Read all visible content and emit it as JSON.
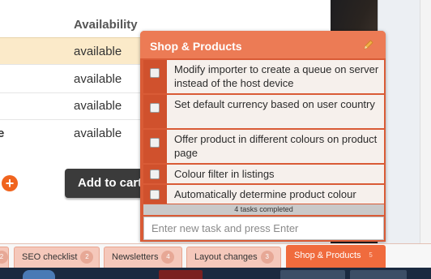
{
  "shop": {
    "availability_header": "Availability",
    "rows": [
      {
        "cut_label": "",
        "value": "available"
      },
      {
        "cut_label": "",
        "value": "available"
      },
      {
        "cut_label": "",
        "value": "available"
      },
      {
        "cut_label": "e",
        "value": "available"
      }
    ],
    "add_to_cart_label": "Add to cart",
    "plus_icon": "+"
  },
  "widget": {
    "title": "Shop & Products",
    "edit_icon": "pencil-icon",
    "tasks": [
      {
        "text": "Modify importer to create a queue on server instead of the host device",
        "checked": false
      },
      {
        "text": "Set default currency based on user country",
        "checked": false
      },
      {
        "text": "Offer product in different colours on product page",
        "checked": false
      },
      {
        "text": "Colour filter in listings",
        "checked": false
      },
      {
        "text": "Automatically determine product colour",
        "checked": false
      }
    ],
    "progress_text": "4 tasks completed",
    "new_task_placeholder": "Enter new task and press Enter"
  },
  "tabs": [
    {
      "label": "",
      "count": "2",
      "active": false
    },
    {
      "label": "SEO checklist",
      "count": "2",
      "active": false
    },
    {
      "label": "Newsletters",
      "count": "4",
      "active": false
    },
    {
      "label": "Layout changes",
      "count": "3",
      "active": false
    },
    {
      "label": "Shop & Products",
      "count": "5",
      "active": true
    }
  ],
  "colors": {
    "accent": "#f06b3d",
    "widget_header": "#ec7b55",
    "widget_body": "#d95b36",
    "highlight_row": "#fbeac9"
  }
}
